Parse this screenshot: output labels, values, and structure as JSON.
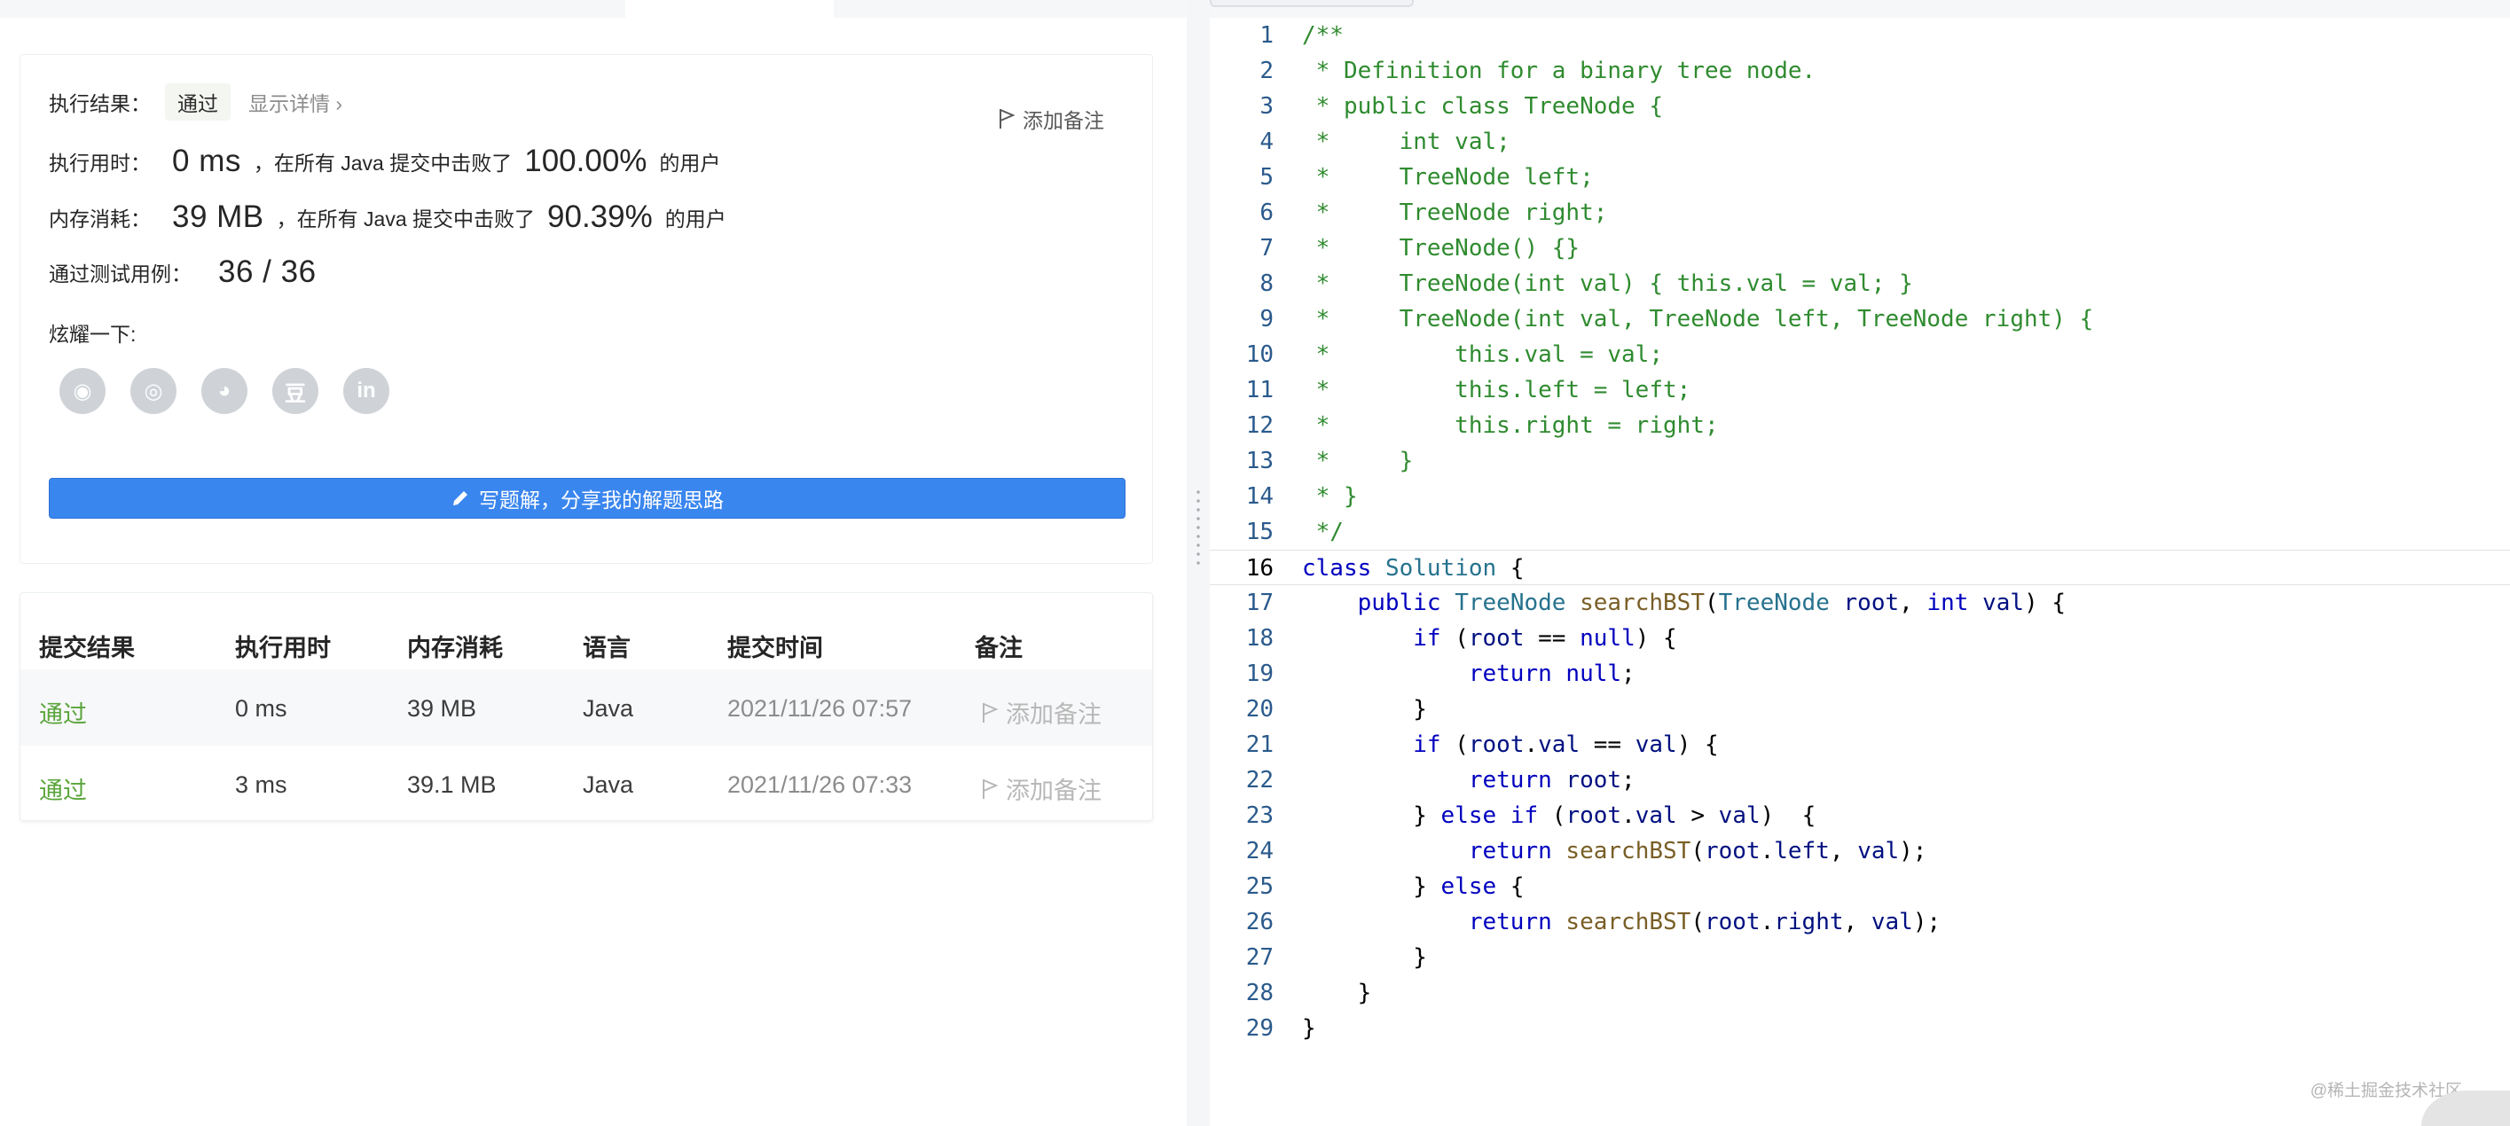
{
  "result": {
    "exec_result_label": "执行结果：",
    "status_badge": "通过",
    "show_details": "显示详情 ›",
    "add_note": "添加备注",
    "runtime_label": "执行用时：",
    "runtime_value": "0 ms",
    "beat_prefix": "，在所有 Java 提交中击败了",
    "runtime_pct": "100.00%",
    "beat_suffix": "的用户",
    "memory_label": "内存消耗：",
    "memory_value": "39 MB",
    "memory_pct": "90.39%",
    "tests_label": "通过测试用例：",
    "tests_value": "36 / 36",
    "share_label": "炫耀一下:",
    "share_icons": [
      "wechat-icon",
      "weibo-icon",
      "qq-icon",
      "douban-icon",
      "linkedin-icon"
    ],
    "share_glyphs": [
      "◉",
      "◎",
      "◕",
      "豆",
      "in"
    ],
    "write_button": "写题解，分享我的解题思路"
  },
  "submissions": {
    "headers": [
      "提交结果",
      "执行用时",
      "内存消耗",
      "语言",
      "提交时间",
      "备注"
    ],
    "rows": [
      {
        "status": "通过",
        "runtime": "0 ms",
        "memory": "39 MB",
        "lang": "Java",
        "time": "2021/11/26 07:57",
        "note": "添加备注"
      },
      {
        "status": "通过",
        "runtime": "3 ms",
        "memory": "39.1 MB",
        "lang": "Java",
        "time": "2021/11/26 07:33",
        "note": "添加备注"
      }
    ]
  },
  "editor": {
    "line_numbers": [
      "1",
      "2",
      "3",
      "4",
      "5",
      "6",
      "7",
      "8",
      "9",
      "10",
      "11",
      "12",
      "13",
      "14",
      "15",
      "16",
      "17",
      "18",
      "19",
      "20",
      "21",
      "22",
      "23",
      "24",
      "25",
      "26",
      "27",
      "28",
      "29"
    ],
    "comment_lines": [
      "/**",
      " * Definition for a binary tree node.",
      " * public class TreeNode {",
      " *     int val;",
      " *     TreeNode left;",
      " *     TreeNode right;",
      " *     TreeNode() {}",
      " *     TreeNode(int val) { this.val = val; }",
      " *     TreeNode(int val, TreeNode left, TreeNode right) {",
      " *         this.val = val;",
      " *         this.left = left;",
      " *         this.right = right;",
      " *     }",
      " * }",
      " */"
    ],
    "code_lines": [
      "class Solution {",
      "    public TreeNode searchBST(TreeNode root, int val) {",
      "        if (root == null) {",
      "            return null;",
      "        }",
      "        if (root.val == val) {",
      "            return root;",
      "        } else if (root.val > val)  {",
      "            return searchBST(root.left, val);",
      "        } else {",
      "            return searchBST(root.right, val);",
      "        }",
      "    }",
      "}"
    ]
  },
  "watermark": "@稀土掘金技术社区",
  "colors": {
    "accent": "#3a86ef",
    "pass_green": "#5aa53b",
    "comment_green": "#2f8b2f",
    "keyword_blue": "#0000bf"
  }
}
